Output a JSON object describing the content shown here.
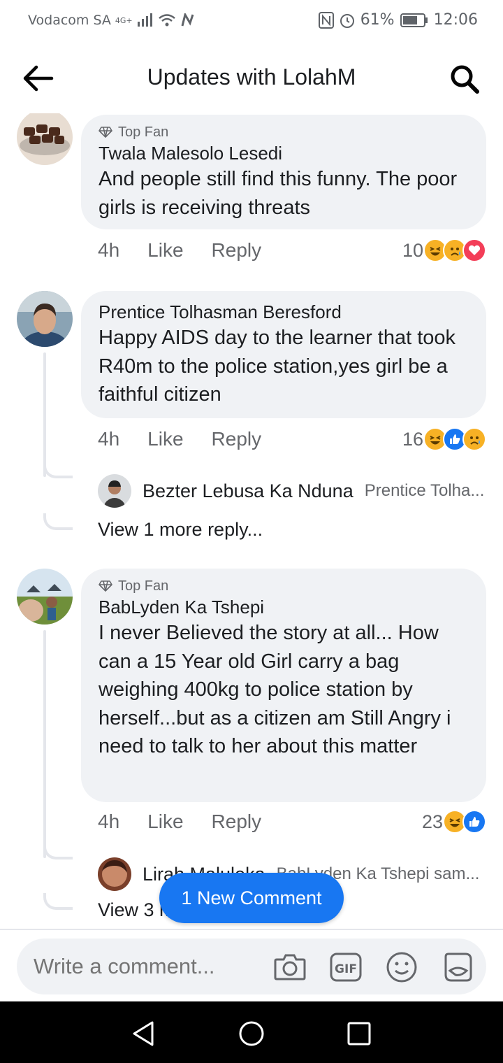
{
  "status_bar": {
    "carrier": "Vodacom SA",
    "network": "4G+",
    "battery": "61%",
    "time": "12:06"
  },
  "header": {
    "title": "Updates with LolahM",
    "back_icon": "arrow-left-icon",
    "search_icon": "search-icon"
  },
  "comments": [
    {
      "badge": "Top Fan",
      "author": "Twala Malesolo Lesedi",
      "text": "And people still find this funny. The poor girls is receiving threats",
      "time": "4h",
      "like": "Like",
      "reply": "Reply",
      "reaction_count": "10",
      "reactions": [
        "haha",
        "sad",
        "love"
      ]
    },
    {
      "badge": "",
      "author": "Prentice Tolhasman Beresford",
      "text": "Happy AIDS day to the learner that took R40m to the police station,yes girl be a faithful citizen",
      "time": "4h",
      "like": "Like",
      "reply": "Reply",
      "reaction_count": "16",
      "reactions": [
        "haha",
        "like",
        "sad"
      ],
      "reply_preview": {
        "name": "Bezter Lebusa Ka Nduna",
        "snippet": "Prentice Tolha..."
      },
      "view_more": "View 1 more reply..."
    },
    {
      "badge": "Top Fan",
      "author": "BabLyden Ka Tshepi",
      "text": "I never Believed the story at all... How can a 15 Year old Girl carry a bag weighing 400kg to police station by herself...but as a citizen am Still Angry i need to talk to her about this matter",
      "time": "4h",
      "like": "Like",
      "reply": "Reply",
      "reaction_count": "23",
      "reactions": [
        "haha",
        "like"
      ],
      "reply_preview": {
        "name": "Lirah Maluleka",
        "snippet": "BabLyden Ka Tshepi sam..."
      },
      "view_more": "View 3 more replies"
    }
  ],
  "new_comment_pill": "1 New Comment",
  "composer": {
    "placeholder": "Write a comment...",
    "icons": [
      "camera-icon",
      "gif-icon",
      "emoji-icon",
      "sticker-icon"
    ]
  },
  "colors": {
    "accent": "#1877f2",
    "bubble": "#f0f2f5",
    "secondary_text": "#65676b",
    "haha": "#f7b125",
    "love": "#f33e58"
  }
}
